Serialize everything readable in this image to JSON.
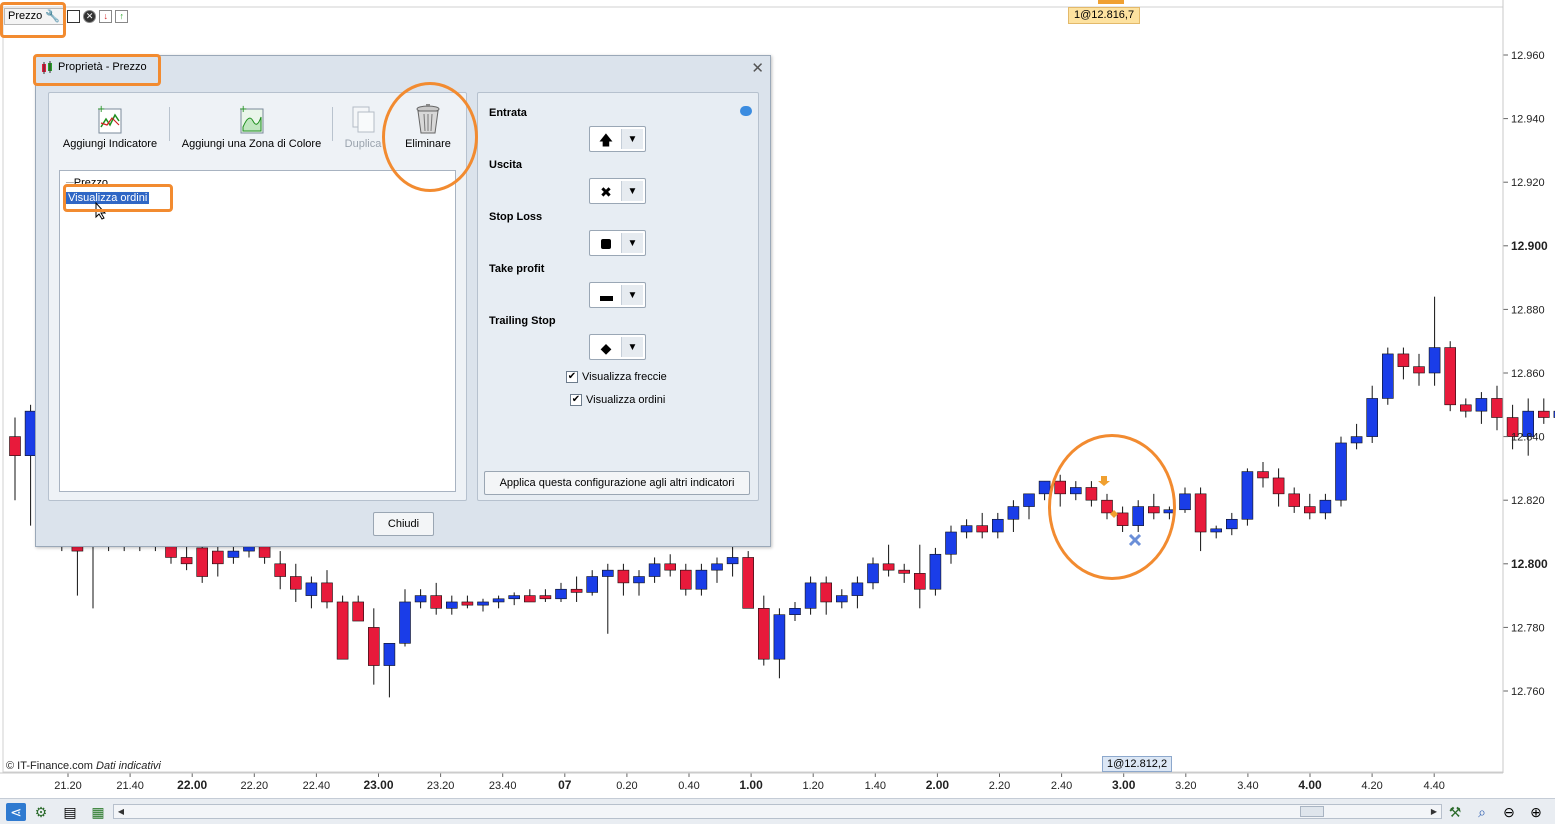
{
  "top_toolbar": {
    "indicator_name": "Prezzo"
  },
  "price_tags": {
    "top": "1@12.816,7",
    "bottom": "1@12.812,2"
  },
  "copyright": {
    "source": "© IT-Finance.com",
    "note": "Dati indicativi"
  },
  "price_axis": {
    "labels": [
      {
        "text": "12.960",
        "value": 12960,
        "bold": false
      },
      {
        "text": "12.940",
        "value": 12940,
        "bold": false
      },
      {
        "text": "12.920",
        "value": 12920,
        "bold": false
      },
      {
        "text": "12.900",
        "value": 12900,
        "bold": true
      },
      {
        "text": "12.880",
        "value": 12880,
        "bold": false
      },
      {
        "text": "12.860",
        "value": 12860,
        "bold": false
      },
      {
        "text": "12.840",
        "value": 12840,
        "bold": false
      },
      {
        "text": "12.820",
        "value": 12820,
        "bold": false
      },
      {
        "text": "12.800",
        "value": 12800,
        "bold": true
      },
      {
        "text": "12.780",
        "value": 12780,
        "bold": false
      },
      {
        "text": "12.760",
        "value": 12760,
        "bold": false
      }
    ]
  },
  "time_axis": {
    "labels": [
      {
        "text": "21.20",
        "bold": false
      },
      {
        "text": "21.40",
        "bold": false
      },
      {
        "text": "22.00",
        "bold": true
      },
      {
        "text": "22.20",
        "bold": false
      },
      {
        "text": "22.40",
        "bold": false
      },
      {
        "text": "23.00",
        "bold": true
      },
      {
        "text": "23.20",
        "bold": false
      },
      {
        "text": "23.40",
        "bold": false
      },
      {
        "text": "07",
        "bold": true
      },
      {
        "text": "0.20",
        "bold": false
      },
      {
        "text": "0.40",
        "bold": false
      },
      {
        "text": "1.00",
        "bold": true
      },
      {
        "text": "1.20",
        "bold": false
      },
      {
        "text": "1.40",
        "bold": false
      },
      {
        "text": "2.00",
        "bold": true
      },
      {
        "text": "2.20",
        "bold": false
      },
      {
        "text": "2.40",
        "bold": false
      },
      {
        "text": "3.00",
        "bold": true
      },
      {
        "text": "3.20",
        "bold": false
      },
      {
        "text": "3.40",
        "bold": false
      },
      {
        "text": "4.00",
        "bold": true
      },
      {
        "text": "4.20",
        "bold": false
      },
      {
        "text": "4.40",
        "bold": false
      }
    ]
  },
  "chart_data": {
    "type": "candlestick",
    "up_color": "#1a3de8",
    "down_color": "#e81a3b",
    "y_range": [
      12740,
      12970
    ],
    "candles": [
      [
        12840,
        12846,
        12820,
        12834
      ],
      [
        12834,
        12850,
        12812,
        12848
      ],
      [
        12810,
        12814,
        12806,
        12808
      ],
      [
        12808,
        12812,
        12804,
        12806
      ],
      [
        12812,
        12816,
        12790,
        12804
      ],
      [
        12806,
        12810,
        12786,
        12808
      ],
      [
        12808,
        12812,
        12804,
        12810
      ],
      [
        12806,
        12810,
        12804,
        12808
      ],
      [
        12808,
        12812,
        12804,
        12806
      ],
      [
        12806,
        12812,
        12804,
        12808
      ],
      [
        12806,
        12810,
        12800,
        12802
      ],
      [
        12802,
        12806,
        12798,
        12800
      ],
      [
        12805,
        12808,
        12794,
        12796
      ],
      [
        12804,
        12808,
        12796,
        12800
      ],
      [
        12802,
        12806,
        12800,
        12804
      ],
      [
        12804,
        12808,
        12802,
        12806
      ],
      [
        12806,
        12810,
        12800,
        12802
      ],
      [
        12800,
        12804,
        12792,
        12796
      ],
      [
        12796,
        12800,
        12788,
        12792
      ],
      [
        12790,
        12796,
        12786,
        12794
      ],
      [
        12794,
        12798,
        12786,
        12788
      ],
      [
        12788,
        12790,
        12774,
        12770
      ],
      [
        12788,
        12790,
        12786,
        12782
      ],
      [
        12780,
        12786,
        12762,
        12768
      ],
      [
        12768,
        12772,
        12758,
        12775
      ],
      [
        12775,
        12792,
        12774,
        12788
      ],
      [
        12788,
        12792,
        12786,
        12790
      ],
      [
        12790,
        12794,
        12784,
        12786
      ],
      [
        12786,
        12790,
        12784,
        12788
      ],
      [
        12788,
        12790,
        12786,
        12787
      ],
      [
        12787,
        12789,
        12785,
        12788
      ],
      [
        12788,
        12790,
        12786,
        12789
      ],
      [
        12789,
        12791,
        12787,
        12790
      ],
      [
        12790,
        12792,
        12788,
        12788
      ],
      [
        12790,
        12792,
        12788,
        12789
      ],
      [
        12789,
        12794,
        12788,
        12792
      ],
      [
        12792,
        12796,
        12788,
        12791
      ],
      [
        12791,
        12798,
        12790,
        12796
      ],
      [
        12796,
        12800,
        12778,
        12798
      ],
      [
        12798,
        12800,
        12790,
        12794
      ],
      [
        12794,
        12798,
        12790,
        12796
      ],
      [
        12796,
        12802,
        12794,
        12800
      ],
      [
        12800,
        12803,
        12796,
        12798
      ],
      [
        12798,
        12800,
        12790,
        12792
      ],
      [
        12792,
        12800,
        12790,
        12798
      ],
      [
        12798,
        12802,
        12794,
        12800
      ],
      [
        12800,
        12806,
        12796,
        12802
      ],
      [
        12802,
        12804,
        12790,
        12786
      ],
      [
        12786,
        12790,
        12768,
        12770
      ],
      [
        12770,
        12786,
        12764,
        12784
      ],
      [
        12784,
        12788,
        12782,
        12786
      ],
      [
        12786,
        12796,
        12784,
        12794
      ],
      [
        12794,
        12796,
        12784,
        12788
      ],
      [
        12788,
        12792,
        12786,
        12790
      ],
      [
        12790,
        12796,
        12786,
        12794
      ],
      [
        12794,
        12802,
        12792,
        12800
      ],
      [
        12800,
        12806,
        12796,
        12798
      ],
      [
        12798,
        12800,
        12794,
        12797
      ],
      [
        12797,
        12806,
        12786,
        12792
      ],
      [
        12792,
        12805,
        12790,
        12803
      ],
      [
        12803,
        12812,
        12800,
        12810
      ],
      [
        12810,
        12814,
        12808,
        12812
      ],
      [
        12812,
        12816,
        12808,
        12810
      ],
      [
        12810,
        12816,
        12808,
        12814
      ],
      [
        12814,
        12820,
        12810,
        12818
      ],
      [
        12818,
        12822,
        12814,
        12822
      ],
      [
        12822,
        12826,
        12820,
        12826
      ],
      [
        12826,
        12828,
        12818,
        12822
      ],
      [
        12822,
        12826,
        12820,
        12824
      ],
      [
        12824,
        12826,
        12818,
        12820
      ],
      [
        12820,
        12822,
        12814,
        12816
      ],
      [
        12816,
        12818,
        12810,
        12812
      ],
      [
        12812,
        12820,
        12810,
        12818
      ],
      [
        12818,
        12822,
        12814,
        12816
      ],
      [
        12816,
        12818,
        12814,
        12817
      ],
      [
        12817,
        12824,
        12816,
        12822
      ],
      [
        12822,
        12824,
        12804,
        12810
      ],
      [
        12810,
        12812,
        12808,
        12811
      ],
      [
        12811,
        12816,
        12809,
        12814
      ],
      [
        12814,
        12830,
        12812,
        12829
      ],
      [
        12829,
        12832,
        12824,
        12827
      ],
      [
        12827,
        12830,
        12818,
        12822
      ],
      [
        12822,
        12824,
        12816,
        12818
      ],
      [
        12818,
        12822,
        12814,
        12816
      ],
      [
        12816,
        12822,
        12814,
        12820
      ],
      [
        12820,
        12840,
        12818,
        12838
      ],
      [
        12838,
        12844,
        12836,
        12840
      ],
      [
        12840,
        12856,
        12838,
        12852
      ],
      [
        12852,
        12868,
        12850,
        12866
      ],
      [
        12866,
        12868,
        12858,
        12862
      ],
      [
        12862,
        12866,
        12856,
        12860
      ],
      [
        12860,
        12884,
        12856,
        12868
      ],
      [
        12868,
        12870,
        12848,
        12850
      ],
      [
        12850,
        12852,
        12846,
        12848
      ],
      [
        12848,
        12854,
        12844,
        12852
      ],
      [
        12852,
        12856,
        12842,
        12846
      ],
      [
        12846,
        12850,
        12836,
        12840
      ],
      [
        12840,
        12852,
        12834,
        12848
      ],
      [
        12848,
        12852,
        12844,
        12846
      ],
      [
        12846,
        12850,
        12844,
        12848
      ],
      [
        12848,
        12856,
        12844,
        12852
      ]
    ]
  },
  "dialog": {
    "title": "Proprietà - Prezzo",
    "toolbar": {
      "add_indicator": "Aggiungi Indicatore",
      "add_color_zone": "Aggiungi una Zona di Colore",
      "duplicate": "Duplica",
      "delete": "Eliminare"
    },
    "tree": {
      "parent": "Prezzo",
      "child": "Visualizza ordini"
    },
    "fields": {
      "entry": "Entrata",
      "exit": "Uscita",
      "stop_loss": "Stop Loss",
      "take_profit": "Take profit",
      "trailing_stop": "Trailing Stop"
    },
    "checkboxes": {
      "show_arrows": "Visualizza freccie",
      "show_orders": "Visualizza ordini"
    },
    "apply_button": "Applica questa configurazione agli altri indicatori",
    "close_button": "Chiudi"
  },
  "colors": {
    "highlight": "#f28b30",
    "selection": "#2f67c5",
    "dialog_bg": "#dbe3ec"
  }
}
